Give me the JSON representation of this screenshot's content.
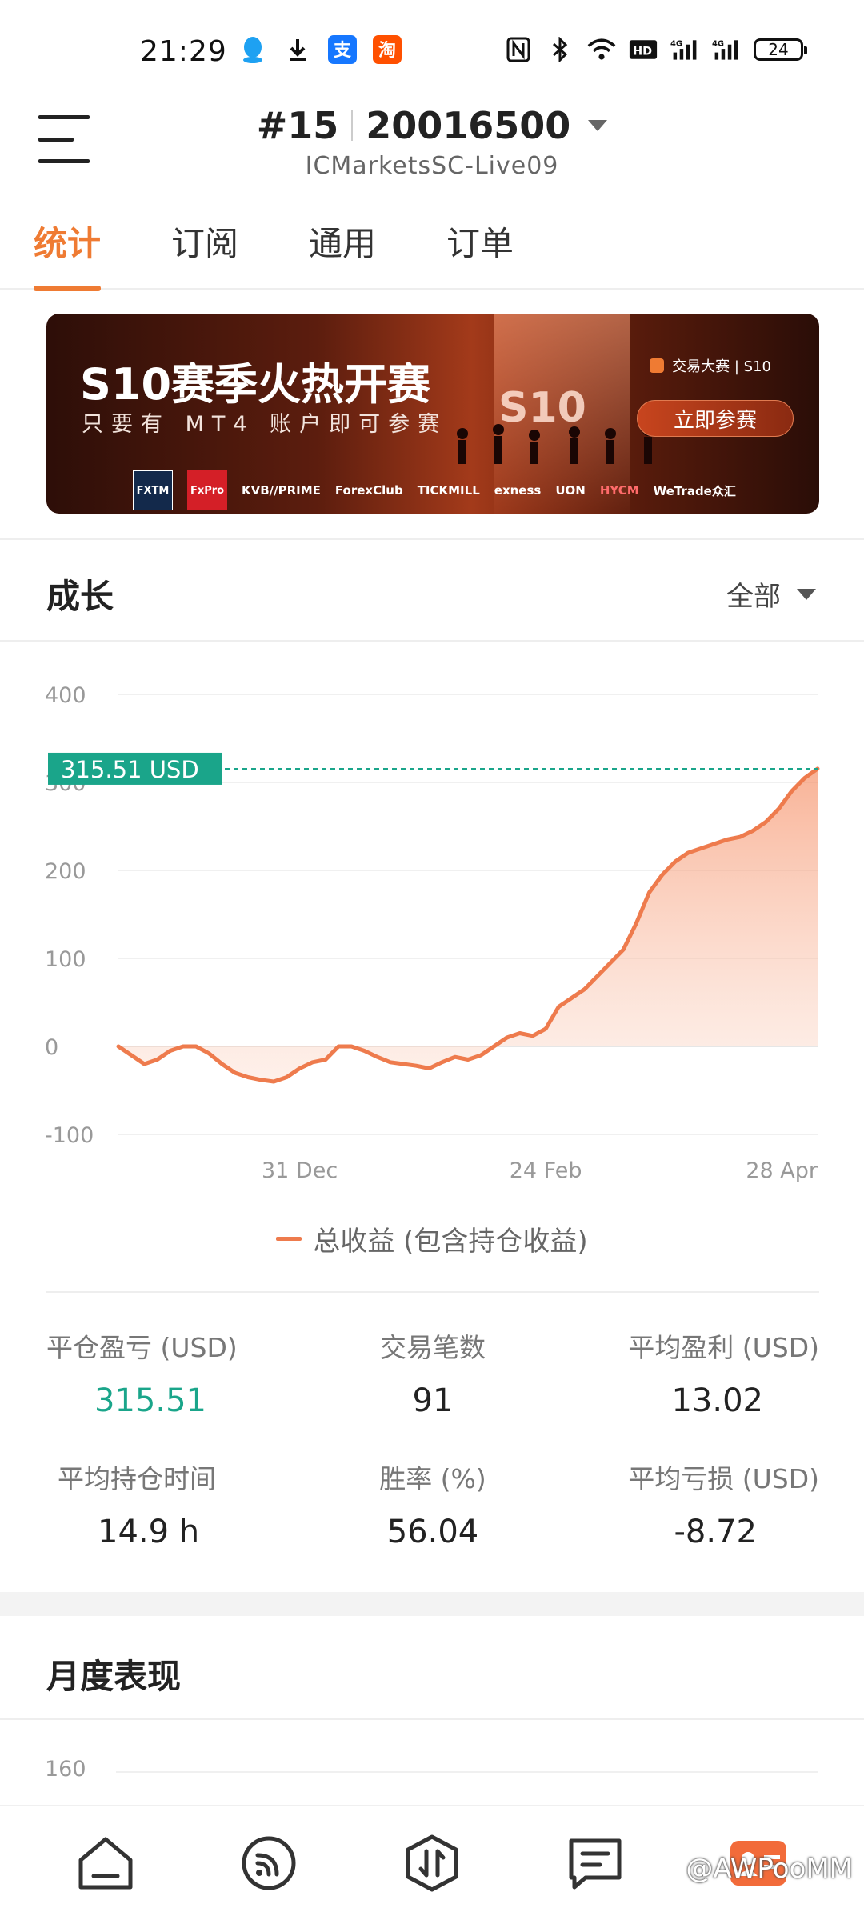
{
  "status_bar": {
    "time": "21:29",
    "battery": "24",
    "icons_left": [
      "qq-icon",
      "download-icon",
      "alipay-icon",
      "taobao-icon"
    ],
    "icons_right": [
      "nfc-icon",
      "bluetooth-icon",
      "wifi-icon",
      "hd-icon",
      "signal-4g-icon",
      "signal-4g-icon"
    ]
  },
  "header": {
    "rank": "#15",
    "account": "20016500",
    "server": "ICMarketsSC-Live09"
  },
  "tabs": [
    {
      "label": "统计",
      "active": true
    },
    {
      "label": "订阅",
      "active": false
    },
    {
      "label": "通用",
      "active": false
    },
    {
      "label": "订单",
      "active": false
    }
  ],
  "banner": {
    "title": "S10赛季火热开赛",
    "subtitle": "只要有 MT4 账户即可参赛",
    "emblem": "S10",
    "tag": "交易大赛 | S10",
    "button": "立即参赛",
    "logos": [
      "FXTM",
      "FxPro",
      "KVB//PRIME",
      "ForexClub",
      "TICKMILL",
      "exness",
      "UON",
      "HYCM",
      "WeTrade众汇"
    ]
  },
  "growth": {
    "title": "成长",
    "filter": "全部",
    "legend": "总收益 (包含持仓收益)",
    "current_label": "315.51 USD"
  },
  "chart_data": {
    "type": "area",
    "title": "",
    "xlabel": "",
    "ylabel": "",
    "ylim": [
      -100,
      400
    ],
    "yticks": [
      "400",
      "300",
      "200",
      "100",
      "0",
      "-100"
    ],
    "xticks": [
      "31 Dec",
      "24 Feb",
      "28 Apr"
    ],
    "xtick_index": [
      14,
      33,
      55
    ],
    "current_value": 315.51,
    "color": "#ee7b4d",
    "series": [
      {
        "values": [
          0,
          -10,
          -20,
          -15,
          -5,
          0,
          0,
          -8,
          -20,
          -30,
          -35,
          -38,
          -40,
          -35,
          -25,
          -18,
          -15,
          0,
          0,
          -5,
          -12,
          -18,
          -20,
          -22,
          -25,
          -18,
          -12,
          -15,
          -10,
          0,
          10,
          15,
          12,
          20,
          45,
          55,
          65,
          80,
          95,
          110,
          140,
          175,
          195,
          210,
          220,
          225,
          230,
          235,
          238,
          245,
          255,
          270,
          290,
          305,
          315.51
        ]
      }
    ]
  },
  "stats": [
    {
      "label": "平仓盈亏 (USD)",
      "value": "315.51",
      "highlight": true
    },
    {
      "label": "交易笔数",
      "value": "91"
    },
    {
      "label": "平均盈利 (USD)",
      "value": "13.02"
    },
    {
      "label": "平均持仓时间",
      "value": "14.9 h"
    },
    {
      "label": "胜率 (%)",
      "value": "56.04"
    },
    {
      "label": "平均亏损 (USD)",
      "value": "-8.72"
    }
  ],
  "monthly": {
    "title": "月度表现",
    "first_tick": "160"
  },
  "bottom_nav": [
    "home-icon",
    "subscribe-icon",
    "trade-icon",
    "message-icon",
    "profile-icon"
  ],
  "watermark": "@AWPooMM"
}
